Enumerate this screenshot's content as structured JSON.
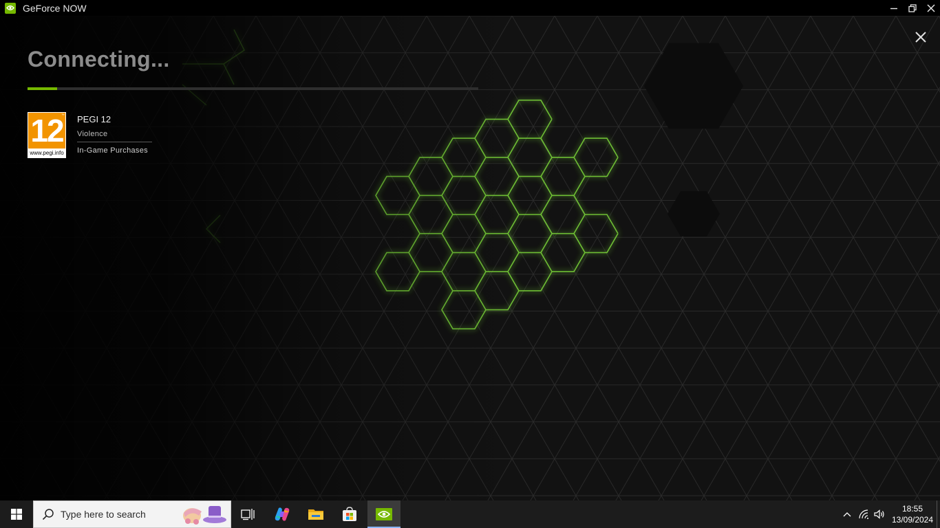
{
  "window": {
    "title": "GeForce NOW"
  },
  "loading": {
    "status": "Connecting...",
    "progress_fraction": 0.065
  },
  "rating": {
    "badge_number": "12",
    "badge_url": "www.pegi.info",
    "title": "PEGI 12",
    "descriptors": [
      "Violence",
      "In-Game Purchases"
    ]
  },
  "taskbar": {
    "search_placeholder": "Type here to search",
    "apps": [
      "task-view",
      "copilot",
      "file-explorer",
      "microsoft-store",
      "geforce-now"
    ],
    "clock_time": "18:55",
    "clock_date": "13/09/2024"
  },
  "colors": {
    "accent": "#76b900",
    "pegi_orange": "#f29400",
    "taskbar": "#1c1c1c"
  }
}
